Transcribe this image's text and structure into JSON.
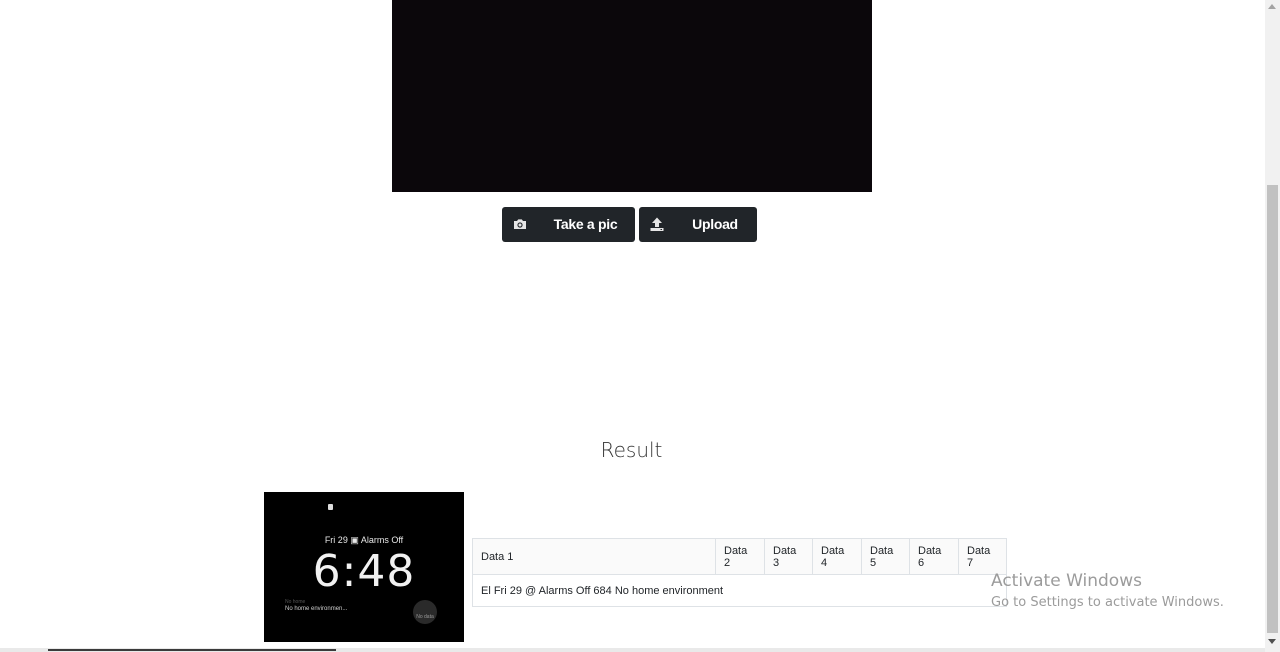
{
  "controls": {
    "take_pic_label": "Take a pic",
    "take_pic_icon": "camera-icon",
    "upload_label": "Upload",
    "upload_icon": "upload-icon"
  },
  "result": {
    "title": "Result",
    "thumbnail": {
      "date_line": "Fri 29 ▣ Alarms Off",
      "time": "6:48",
      "small_note": "No home",
      "note": "No home environmen...",
      "badge": "No data"
    },
    "table": {
      "headers": [
        "Data 1",
        "Data 2",
        "Data 3",
        "Data 4",
        "Data 5",
        "Data 6",
        "Data 7"
      ],
      "rows": [
        [
          "El Fri 29 @ Alarms Off 684 No home environment",
          "",
          "",
          "",
          "",
          "",
          ""
        ]
      ]
    }
  },
  "watermark": {
    "line1": "Activate Windows",
    "line2": "Go to Settings to activate Windows."
  },
  "colors": {
    "button_bg": "#212529",
    "camera_bg": "#0b070b",
    "table_border": "#dee2e6"
  }
}
